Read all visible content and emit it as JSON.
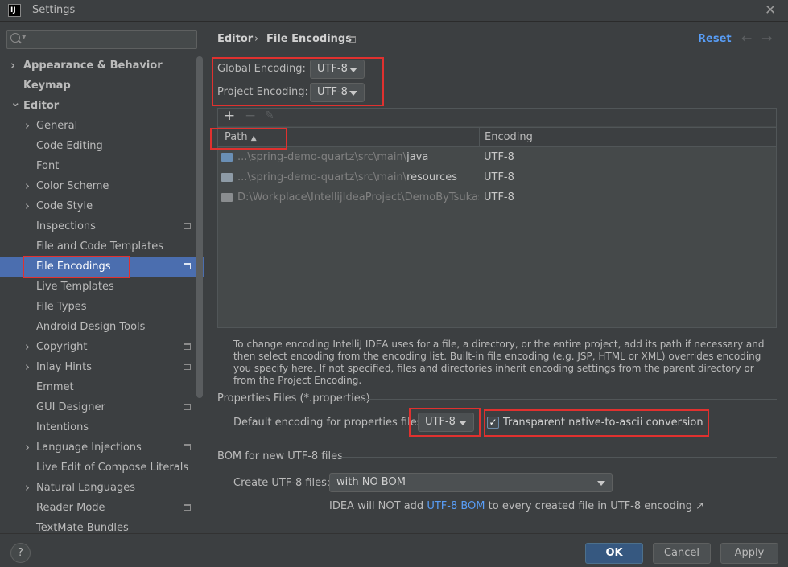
{
  "window": {
    "title": "Settings",
    "app_icon": "IJ"
  },
  "sidebar": {
    "search_placeholder": "",
    "items": [
      {
        "label": "Appearance & Behavior",
        "bold": true,
        "chevron": true,
        "indent": 0
      },
      {
        "label": "Keymap",
        "bold": true,
        "chevron": false,
        "indent": 0
      },
      {
        "label": "Editor",
        "bold": true,
        "chevron": "open",
        "indent": 0
      },
      {
        "label": "General",
        "chevron": true,
        "indent": 1
      },
      {
        "label": "Code Editing",
        "indent": 1
      },
      {
        "label": "Font",
        "indent": 1
      },
      {
        "label": "Color Scheme",
        "chevron": true,
        "indent": 1
      },
      {
        "label": "Code Style",
        "chevron": true,
        "indent": 1
      },
      {
        "label": "Inspections",
        "indent": 1,
        "project_icon": true
      },
      {
        "label": "File and Code Templates",
        "indent": 1
      },
      {
        "label": "File Encodings",
        "indent": 1,
        "project_icon": true,
        "selected": true
      },
      {
        "label": "Live Templates",
        "indent": 1
      },
      {
        "label": "File Types",
        "indent": 1
      },
      {
        "label": "Android Design Tools",
        "indent": 1
      },
      {
        "label": "Copyright",
        "chevron": true,
        "indent": 1,
        "project_icon": true
      },
      {
        "label": "Inlay Hints",
        "chevron": true,
        "indent": 1,
        "project_icon": true
      },
      {
        "label": "Emmet",
        "indent": 1
      },
      {
        "label": "GUI Designer",
        "indent": 1,
        "project_icon": true
      },
      {
        "label": "Intentions",
        "indent": 1
      },
      {
        "label": "Language Injections",
        "chevron": true,
        "indent": 1,
        "project_icon": true
      },
      {
        "label": "Live Edit of Compose Literals",
        "indent": 1
      },
      {
        "label": "Natural Languages",
        "chevron": true,
        "indent": 1
      },
      {
        "label": "Reader Mode",
        "indent": 1,
        "project_icon": true
      },
      {
        "label": "TextMate Bundles",
        "indent": 1
      }
    ]
  },
  "header": {
    "breadcrumb_parent": "Editor",
    "breadcrumb_sep": "›",
    "breadcrumb_current": "File Encodings",
    "reset_label": "Reset"
  },
  "encodings": {
    "global_label": "Global Encoding:",
    "global_value": "UTF-8",
    "project_label": "Project Encoding:",
    "project_value": "UTF-8"
  },
  "table": {
    "toolbar": {
      "add": "+",
      "remove": "−",
      "edit": "✎"
    },
    "columns": {
      "path": "Path",
      "encoding": "Encoding"
    },
    "rows": [
      {
        "path_dim": "...\\spring-demo-quartz\\src\\main\\",
        "path_main": "java",
        "encoding": "UTF-8",
        "icon": "source-folder-icon"
      },
      {
        "path_dim": "...\\spring-demo-quartz\\src\\main\\",
        "path_main": "resources",
        "encoding": "UTF-8",
        "icon": "resources-folder-icon"
      },
      {
        "path_dim": "D:\\Workplace\\IntellijIdeaProject\\DemoByTsukasa\\sp",
        "path_main": "",
        "encoding": "UTF-8",
        "icon": "folder-icon"
      }
    ]
  },
  "note": "To change encoding IntelliJ IDEA uses for a file, a directory, or the entire project, add its path if necessary and then select encoding from the encoding list. Built-in file encoding (e.g. JSP, HTML or XML) overrides encoding you specify here. If not specified, files and directories inherit encoding settings from the parent directory or from the Project Encoding.",
  "properties": {
    "section_title": "Properties Files (*.properties)",
    "default_label": "Default encoding for properties files:",
    "default_value": "UTF-8",
    "transparent_label": "Transparent native-to-ascii conversion",
    "transparent_checked": true
  },
  "bom": {
    "section_title": "BOM for new UTF-8 files",
    "create_label": "Create UTF-8 files:",
    "create_value": "with NO BOM",
    "hint_prefix": "IDEA will NOT add ",
    "hint_link": "UTF-8 BOM",
    "hint_suffix": " to every created file in UTF-8 encoding ↗"
  },
  "footer": {
    "help": "?",
    "ok": "OK",
    "cancel": "Cancel",
    "apply": "Apply"
  },
  "colors": {
    "background": "#3c3f41",
    "selection": "#4b6eaf",
    "accent_link": "#589df6",
    "highlight_box": "#e0312f",
    "primary_button": "#365880"
  }
}
